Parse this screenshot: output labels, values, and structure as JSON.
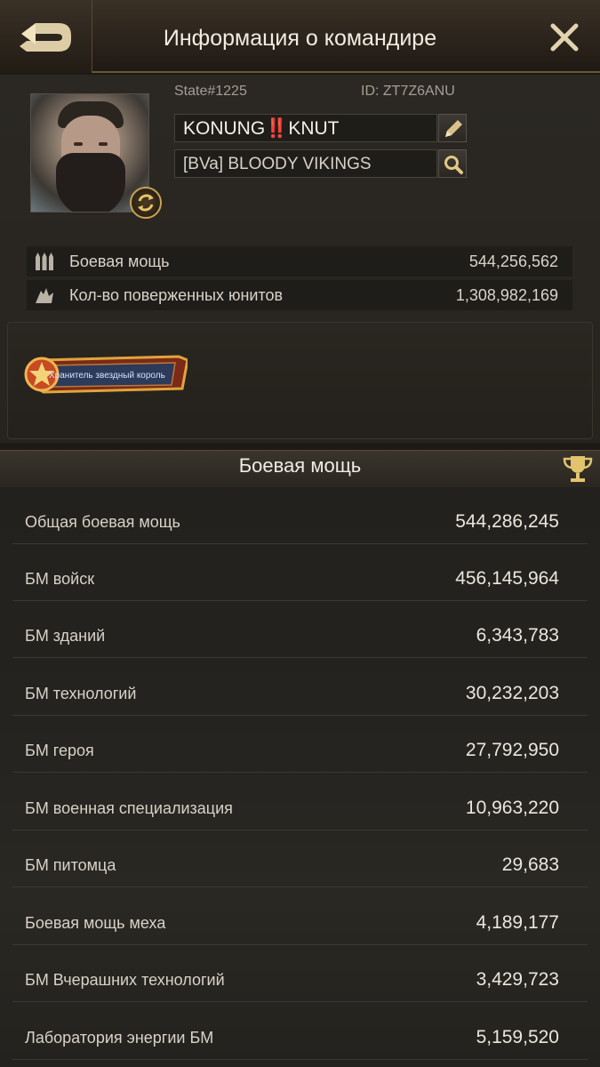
{
  "header": {
    "title": "Информация о командире",
    "back_icon": "back-arrow-icon",
    "close_icon": "close-icon"
  },
  "profile": {
    "state": "State#1225",
    "id": "ID: ZT7Z6ANU",
    "name": "KONUNG‼️KNUT",
    "alliance": "[BVa] BLOODY VIKINGS",
    "badge_text": "Хранитель звездный король"
  },
  "stats": [
    {
      "icon": "bullets-icon",
      "label": "Боевая мощь",
      "value": "544,256,562"
    },
    {
      "icon": "kills-icon",
      "label": "Кол-во поверженных юнитов",
      "value": "1,308,982,169"
    }
  ],
  "power_section": {
    "title": "Боевая мощь",
    "rows": [
      {
        "label": "Общая боевая мощь",
        "value": "544,286,245"
      },
      {
        "label": "БМ войск",
        "value": "456,145,964"
      },
      {
        "label": "БМ зданий",
        "value": "6,343,783"
      },
      {
        "label": "БМ технологий",
        "value": "30,232,203"
      },
      {
        "label": "БМ героя",
        "value": "27,792,950"
      },
      {
        "label": "БМ военная специализация",
        "value": "10,963,220"
      },
      {
        "label": "БМ питомца",
        "value": "29,683"
      },
      {
        "label": "Боевая мощь меха",
        "value": "4,189,177"
      },
      {
        "label": "БМ Вчерашних технологий",
        "value": "3,429,723"
      },
      {
        "label": "Лаборатория энергии БМ",
        "value": "5,159,520"
      }
    ]
  },
  "colors": {
    "accent_gold": "#c9a256",
    "background": "#1c1a17"
  }
}
